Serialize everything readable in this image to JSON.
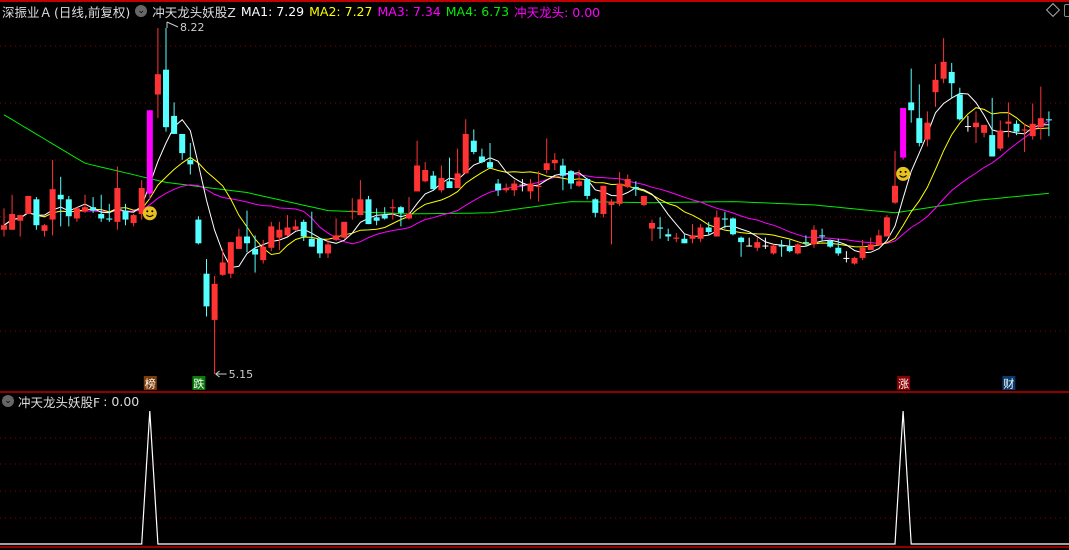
{
  "header": {
    "stock_name": "深振业Ａ",
    "period": "(日线,前复权)",
    "indicator_name": "冲天龙头妖股Z",
    "ma1": "MA1: 7.29",
    "ma2": "MA2: 7.27",
    "ma3": "MA3: 7.34",
    "ma4": "MA4: 6.73",
    "signal": "冲天龙头: 0.00"
  },
  "sub_panel": {
    "title": "冲天龙头妖股F",
    "value": ": 0.00"
  },
  "colors": {
    "up": "#ff3333",
    "down": "#54ffff",
    "limit": "#ff00ff",
    "ma1": "#ffffff",
    "ma2": "#ffff00",
    "ma3": "#ff00ff",
    "ma4": "#00ee00",
    "grid": "#8b0000",
    "separator": "#c00000"
  },
  "chart_data": {
    "type": "candlestick",
    "high_label": "8.22",
    "low_label": "5.15",
    "high_index": 20,
    "low_index": 26,
    "price_range": [
      5.15,
      8.22
    ],
    "limit_up_indices": [
      18,
      111
    ],
    "smiley_indices": [
      18,
      111
    ],
    "ma_periods": [
      5,
      10,
      20
    ],
    "ma4_samples": {
      "step": 10,
      "values": [
        7.45,
        7.02,
        6.85,
        6.76,
        6.6,
        6.57,
        6.58,
        6.68,
        6.67,
        6.68,
        6.65,
        6.58,
        6.69,
        6.76
      ]
    },
    "markers": [
      {
        "index": 18,
        "text": "榜",
        "color": "#7a3d0a"
      },
      {
        "index": 24,
        "text": "跌",
        "color": "#0a7a0a"
      },
      {
        "index": 111,
        "text": "涨",
        "color": "#8a0000"
      },
      {
        "index": 124,
        "text": "财",
        "color": "#0a3a6a"
      }
    ],
    "signal_indices": [
      18,
      111
    ],
    "candles": [
      [
        6.43,
        6.47,
        6.62,
        6.37
      ],
      [
        6.43,
        6.57,
        6.74,
        6.43
      ],
      [
        6.51,
        6.56,
        6.56,
        6.37
      ],
      [
        6.57,
        6.73,
        6.73,
        6.57
      ],
      [
        6.7,
        6.47,
        6.72,
        6.43
      ],
      [
        6.42,
        6.47,
        6.48,
        6.37
      ],
      [
        6.52,
        6.79,
        7.05,
        6.38
      ],
      [
        6.74,
        6.7,
        6.9,
        6.46
      ],
      [
        6.7,
        6.55,
        6.73,
        6.46
      ],
      [
        6.53,
        6.62,
        6.63,
        6.5
      ],
      [
        6.59,
        6.63,
        6.74,
        6.58
      ],
      [
        6.63,
        6.6,
        6.72,
        6.58
      ],
      [
        6.57,
        6.53,
        6.74,
        6.5
      ],
      [
        6.53,
        6.52,
        6.66,
        6.5
      ],
      [
        6.5,
        6.8,
        6.99,
        6.43
      ],
      [
        6.6,
        6.52,
        6.66,
        6.47
      ],
      [
        6.49,
        6.56,
        6.57,
        6.46
      ],
      [
        6.57,
        6.8,
        6.87,
        6.52
      ],
      [
        6.75,
        7.49,
        7.49,
        6.7
      ],
      [
        7.63,
        7.81,
        8.22,
        7.42
      ],
      [
        7.85,
        7.34,
        8.22,
        7.3
      ],
      [
        7.44,
        7.28,
        7.56,
        7.28
      ],
      [
        7.28,
        7.11,
        7.28,
        7.05
      ],
      [
        7.05,
        7.01,
        7.2,
        6.92
      ],
      [
        6.52,
        6.31,
        6.55,
        6.3
      ],
      [
        6.04,
        5.75,
        6.17,
        5.66
      ],
      [
        5.63,
        5.95,
        6.02,
        5.15
      ],
      [
        6.03,
        6.14,
        6.26,
        6.02
      ],
      [
        6.04,
        6.32,
        6.32,
        6.0
      ],
      [
        6.26,
        6.37,
        6.44,
        6.26
      ],
      [
        6.37,
        6.31,
        6.6,
        6.23
      ],
      [
        6.26,
        6.21,
        6.38,
        6.05
      ],
      [
        6.16,
        6.28,
        6.34,
        6.13
      ],
      [
        6.27,
        6.46,
        6.5,
        6.24
      ],
      [
        6.36,
        6.43,
        6.5,
        6.25
      ],
      [
        6.38,
        6.45,
        6.56,
        6.37
      ],
      [
        6.43,
        6.46,
        6.52,
        6.42
      ],
      [
        6.5,
        6.37,
        6.52,
        6.33
      ],
      [
        6.35,
        6.28,
        6.59,
        6.28
      ],
      [
        6.35,
        6.22,
        6.36,
        6.18
      ],
      [
        6.22,
        6.3,
        6.35,
        6.18
      ],
      [
        6.34,
        6.38,
        6.53,
        6.33
      ],
      [
        6.36,
        6.5,
        6.5,
        6.35
      ],
      [
        6.59,
        6.6,
        6.71,
        6.52
      ],
      [
        6.56,
        6.7,
        6.87,
        6.56
      ],
      [
        6.7,
        6.48,
        6.73,
        6.48
      ],
      [
        6.54,
        6.51,
        6.62,
        6.47
      ],
      [
        6.56,
        6.53,
        6.63,
        6.52
      ],
      [
        6.62,
        6.63,
        6.7,
        6.52
      ],
      [
        6.63,
        6.58,
        6.64,
        6.46
      ],
      [
        6.53,
        6.57,
        6.72,
        6.52
      ],
      [
        6.77,
        7.0,
        7.22,
        6.77
      ],
      [
        6.86,
        6.96,
        7.03,
        6.85
      ],
      [
        6.91,
        6.79,
        6.95,
        6.79
      ],
      [
        6.78,
        6.89,
        7.0,
        6.76
      ],
      [
        6.86,
        6.8,
        7.07,
        6.8
      ],
      [
        6.8,
        6.93,
        7.15,
        6.8
      ],
      [
        6.93,
        7.28,
        7.41,
        6.93
      ],
      [
        7.22,
        7.12,
        7.32,
        7.1
      ],
      [
        7.08,
        7.03,
        7.15,
        7.02
      ],
      [
        7.03,
        6.98,
        7.2,
        6.97
      ],
      [
        6.84,
        6.78,
        6.88,
        6.73
      ],
      [
        6.78,
        6.8,
        6.84,
        6.76
      ],
      [
        6.78,
        6.84,
        6.87,
        6.73
      ],
      [
        6.83,
        6.83,
        6.88,
        6.77
      ],
      [
        6.77,
        6.84,
        6.88,
        6.7
      ],
      [
        6.81,
        6.82,
        6.95,
        6.68
      ],
      [
        6.96,
        7.02,
        7.24,
        6.93
      ],
      [
        7.02,
        7.05,
        7.11,
        6.96
      ],
      [
        7.0,
        6.91,
        7.06,
        6.78
      ],
      [
        6.95,
        6.84,
        6.96,
        6.79
      ],
      [
        6.82,
        6.86,
        6.96,
        6.81
      ],
      [
        6.88,
        6.73,
        6.89,
        6.7
      ],
      [
        6.7,
        6.58,
        6.71,
        6.54
      ],
      [
        6.57,
        6.82,
        6.82,
        6.54
      ],
      [
        6.65,
        6.68,
        6.7,
        6.3
      ],
      [
        6.66,
        6.84,
        6.94,
        6.64
      ],
      [
        6.81,
        6.88,
        6.92,
        6.8
      ],
      [
        6.81,
        6.79,
        6.86,
        6.73
      ],
      [
        6.65,
        6.73,
        6.73,
        6.64
      ],
      [
        6.44,
        6.49,
        6.52,
        6.33
      ],
      [
        6.45,
        6.44,
        6.54,
        6.35
      ],
      [
        6.39,
        6.37,
        6.44,
        6.33
      ],
      [
        6.35,
        6.36,
        6.4,
        6.32
      ],
      [
        6.35,
        6.31,
        6.39,
        6.31
      ],
      [
        6.35,
        6.38,
        6.48,
        6.31
      ],
      [
        6.35,
        6.45,
        6.48,
        6.32
      ],
      [
        6.45,
        6.41,
        6.5,
        6.38
      ],
      [
        6.37,
        6.54,
        6.6,
        6.37
      ],
      [
        6.53,
        6.52,
        6.59,
        6.44
      ],
      [
        6.53,
        6.39,
        6.54,
        6.38
      ],
      [
        6.36,
        6.32,
        6.37,
        6.19
      ],
      [
        6.29,
        6.29,
        6.36,
        6.28
      ],
      [
        6.27,
        6.32,
        6.36,
        6.24
      ],
      [
        6.29,
        6.29,
        6.36,
        6.26
      ],
      [
        6.22,
        6.29,
        6.3,
        6.21
      ],
      [
        6.29,
        6.28,
        6.34,
        6.19
      ],
      [
        6.28,
        6.24,
        6.34,
        6.23
      ],
      [
        6.22,
        6.3,
        6.31,
        6.21
      ],
      [
        6.32,
        6.31,
        6.38,
        6.28
      ],
      [
        6.3,
        6.43,
        6.47,
        6.27
      ],
      [
        6.38,
        6.37,
        6.44,
        6.33
      ],
      [
        6.33,
        6.28,
        6.34,
        6.27
      ],
      [
        6.27,
        6.22,
        6.35,
        6.2
      ],
      [
        6.18,
        6.18,
        6.24,
        6.14
      ],
      [
        6.13,
        6.18,
        6.19,
        6.12
      ],
      [
        6.18,
        6.27,
        6.34,
        6.16
      ],
      [
        6.25,
        6.3,
        6.36,
        6.25
      ],
      [
        6.29,
        6.38,
        6.43,
        6.29
      ],
      [
        6.37,
        6.54,
        6.56,
        6.37
      ],
      [
        6.67,
        6.82,
        7.13,
        6.66
      ],
      [
        7.07,
        7.51,
        7.51,
        7.05
      ],
      [
        7.56,
        7.49,
        7.86,
        7.38
      ],
      [
        7.42,
        7.2,
        7.72,
        7.17
      ],
      [
        7.23,
        7.38,
        7.48,
        7.17
      ],
      [
        7.65,
        7.76,
        7.9,
        7.52
      ],
      [
        7.77,
        7.92,
        8.13,
        7.73
      ],
      [
        7.83,
        7.73,
        7.91,
        7.6
      ],
      [
        7.63,
        7.41,
        7.69,
        7.4
      ],
      [
        7.35,
        7.35,
        7.44,
        7.3
      ],
      [
        7.34,
        7.38,
        7.48,
        7.2
      ],
      [
        7.29,
        7.36,
        7.36,
        7.25
      ],
      [
        7.27,
        7.08,
        7.6,
        7.08
      ],
      [
        7.15,
        7.31,
        7.4,
        7.13
      ],
      [
        7.37,
        7.39,
        7.56,
        7.25
      ],
      [
        7.37,
        7.3,
        7.4,
        7.27
      ],
      [
        7.31,
        7.32,
        7.37,
        7.12
      ],
      [
        7.26,
        7.37,
        7.55,
        7.23
      ],
      [
        7.34,
        7.42,
        7.7,
        7.23
      ],
      [
        7.41,
        7.4,
        7.48,
        7.26
      ]
    ]
  }
}
